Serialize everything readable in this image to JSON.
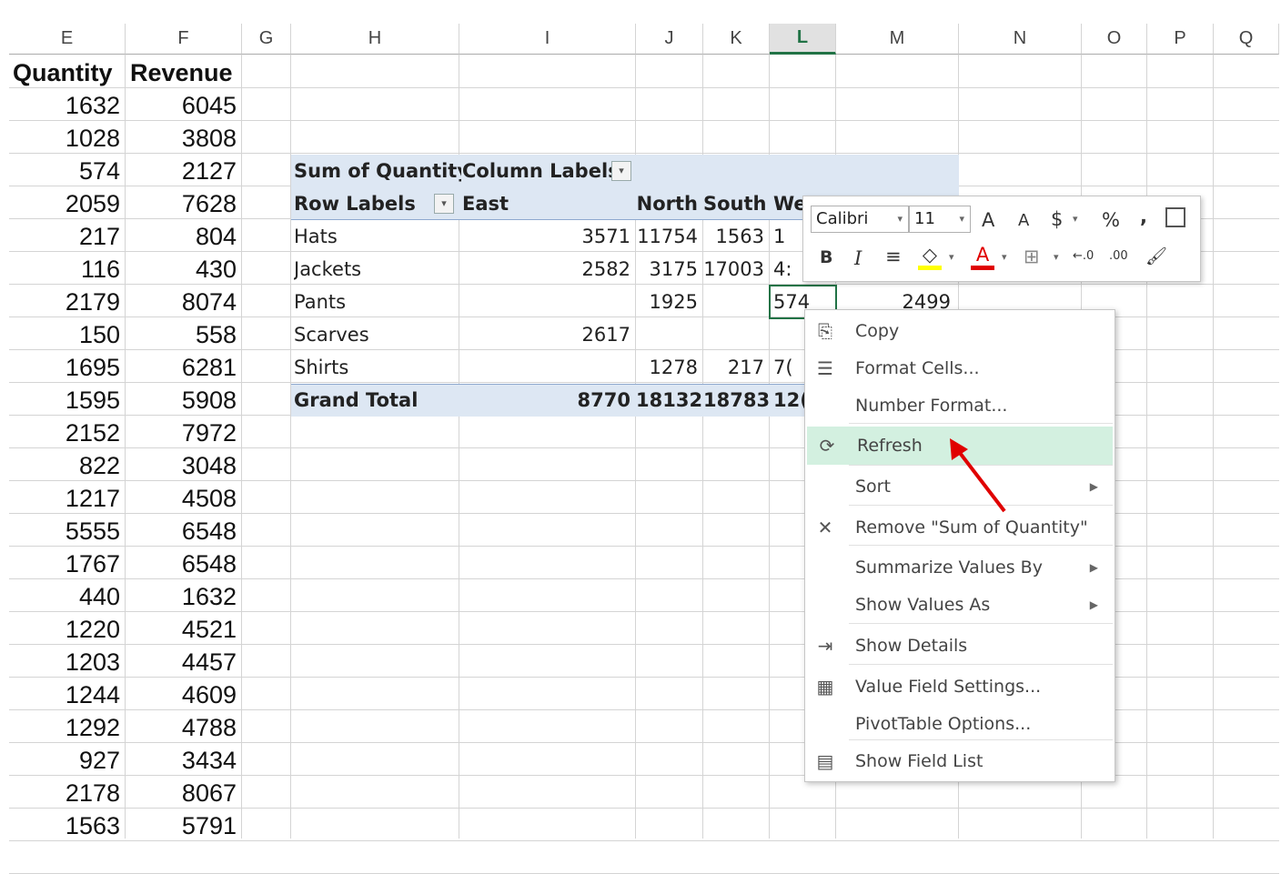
{
  "columns": [
    "E",
    "F",
    "G",
    "H",
    "I",
    "J",
    "K",
    "L",
    "M",
    "N",
    "O",
    "P",
    "Q"
  ],
  "selected_column": "L",
  "source_headers": [
    "Quantity",
    "Revenue"
  ],
  "source_rows": [
    [
      "1632",
      "6045"
    ],
    [
      "1028",
      "3808"
    ],
    [
      "574",
      "2127"
    ],
    [
      "2059",
      "7628"
    ],
    [
      "217",
      "804"
    ],
    [
      "116",
      "430"
    ],
    [
      "2179",
      "8074"
    ],
    [
      "150",
      "558"
    ],
    [
      "1695",
      "6281"
    ],
    [
      "1595",
      "5908"
    ],
    [
      "2152",
      "7972"
    ],
    [
      "822",
      "3048"
    ],
    [
      "1217",
      "4508"
    ],
    [
      "5555",
      "6548"
    ],
    [
      "1767",
      "6548"
    ],
    [
      "440",
      "1632"
    ],
    [
      "1220",
      "4521"
    ],
    [
      "1203",
      "4457"
    ],
    [
      "1244",
      "4609"
    ],
    [
      "1292",
      "4788"
    ],
    [
      "927",
      "3434"
    ],
    [
      "2178",
      "8067"
    ],
    [
      "1563",
      "5791"
    ]
  ],
  "pivot": {
    "value_label": "Sum of Quantity",
    "column_labels": "Column Labels",
    "row_labels": "Row Labels",
    "col_east": "East",
    "col_north": "North",
    "col_south": "South",
    "col_west": "We",
    "rows": [
      {
        "label": "Hats",
        "east": "3571",
        "north": "11754",
        "south": "1563",
        "west": "1"
      },
      {
        "label": "Jackets",
        "east": "2582",
        "north": "3175",
        "south": "17003",
        "west": "4:"
      },
      {
        "label": "Pants",
        "east": "",
        "north": "1925",
        "south": "",
        "west": "574",
        "extra": "2499"
      },
      {
        "label": "Scarves",
        "east": "2617",
        "north": "",
        "south": "",
        "west": ""
      },
      {
        "label": "Shirts",
        "east": "",
        "north": "1278",
        "south": "217",
        "west": "7("
      }
    ],
    "total": {
      "label": "Grand Total",
      "east": "8770",
      "north": "18132",
      "south": "18783",
      "west": "12("
    }
  },
  "mini_toolbar": {
    "font_name": "Calibri",
    "font_size": "11",
    "row1_icons": [
      "font-grow-icon",
      "font-shrink-icon",
      "currency-icon",
      "percent-icon",
      "comma-icon",
      "table-format-icon"
    ],
    "row2_icons": [
      "bold-icon",
      "italic-icon",
      "align-icon",
      "fill-color-icon",
      "font-color-icon",
      "borders-icon",
      "increase-decimal-icon",
      "decrease-decimal-icon",
      "format-painter-icon"
    ],
    "glyphs": {
      "grow": "A",
      "shrink": "A",
      "currency": "$",
      "percent": "%",
      "comma": ",",
      "bold": "B",
      "italic": "I",
      "align": "≡",
      "fillc": "◇",
      "fontc": "A",
      "border": "⊞",
      "incdec": "←.0",
      "decdec": ".00",
      "painter": "🖌"
    },
    "fill_color": "#ffff00",
    "font_color": "#e00000"
  },
  "context_menu": {
    "items": [
      {
        "label": "Copy",
        "icon": "copy-icon",
        "glyph": "⎘"
      },
      {
        "label": "Format Cells...",
        "icon": "format-cells-icon",
        "glyph": "☰"
      },
      {
        "label": "Number Format...",
        "icon": "",
        "glyph": ""
      },
      {
        "label": "Refresh",
        "icon": "refresh-icon",
        "glyph": "⟳"
      },
      {
        "label": "Sort",
        "icon": "",
        "glyph": "",
        "submenu": true
      },
      {
        "label": "Remove \"Sum of Quantity\"",
        "icon": "remove-x-icon",
        "glyph": "✕"
      },
      {
        "label": "Summarize Values By",
        "icon": "",
        "glyph": "",
        "submenu": true
      },
      {
        "label": "Show Values As",
        "icon": "",
        "glyph": "",
        "submenu": true
      },
      {
        "label": "Show Details",
        "icon": "show-details-icon",
        "glyph": "⇥"
      },
      {
        "label": "Value Field Settings...",
        "icon": "value-field-settings-icon",
        "glyph": "▦"
      },
      {
        "label": "PivotTable Options...",
        "icon": "",
        "glyph": ""
      },
      {
        "label": "Show Field List",
        "icon": "field-list-icon",
        "glyph": "▤"
      }
    ],
    "highlighted": "Refresh",
    "highlight_color": "#d3f0e0",
    "submenu_arrow": "▶"
  },
  "annotation_color": "#e00000",
  "dropdown_glyph": "▾"
}
